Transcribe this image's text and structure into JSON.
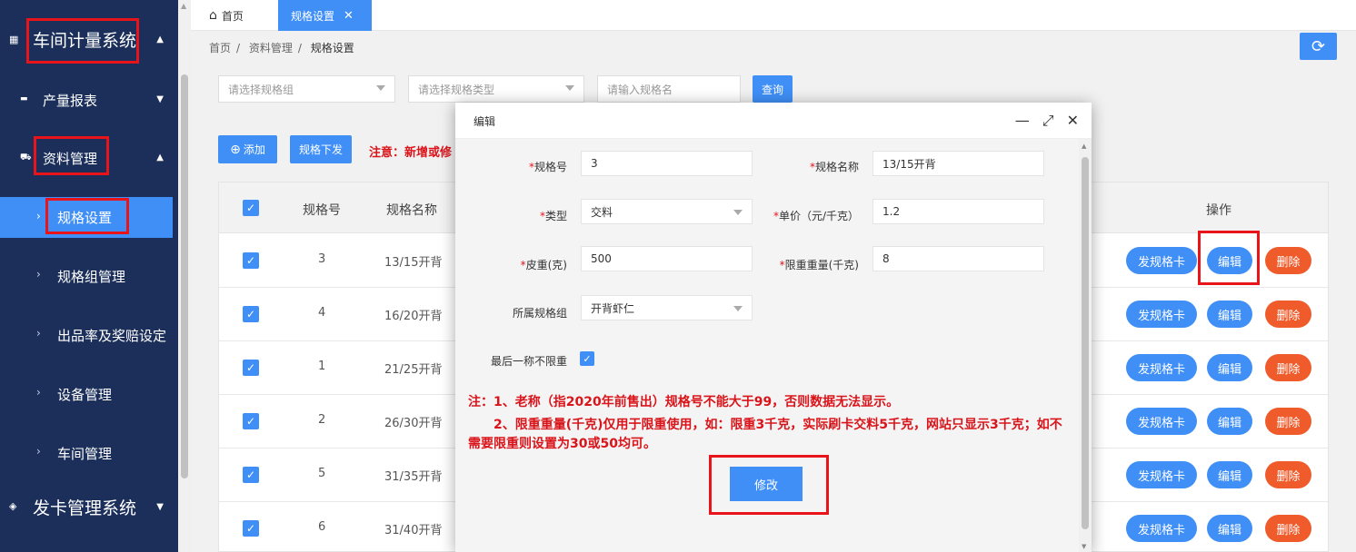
{
  "sidebar": {
    "system_title": "车间计量系统",
    "items": [
      {
        "label": "产量报表"
      },
      {
        "label": "资料管理"
      },
      {
        "label": "规格设置"
      },
      {
        "label": "规格组管理"
      },
      {
        "label": "出品率及奖赔设定"
      },
      {
        "label": "设备管理"
      },
      {
        "label": "车间管理"
      }
    ],
    "card_system": "发卡管理系统"
  },
  "tabs": {
    "home": "首页",
    "active": "规格设置"
  },
  "breadcrumb": [
    "首页",
    "资料管理",
    "规格设置"
  ],
  "filters": {
    "group_placeholder": "请选择规格组",
    "type_placeholder": "请选择规格类型",
    "name_placeholder": "请输入规格名",
    "query_label": "查询"
  },
  "toolbar": {
    "add_label": "添加",
    "dispatch_label": "规格下发",
    "notice": "注意：新增或修"
  },
  "table": {
    "columns": [
      "规格号",
      "规格名称",
      "操作"
    ],
    "rows": [
      {
        "no": "3",
        "name": "13/15开背"
      },
      {
        "no": "4",
        "name": "16/20开背"
      },
      {
        "no": "1",
        "name": "21/25开背"
      },
      {
        "no": "2",
        "name": "26/30开背"
      },
      {
        "no": "5",
        "name": "31/35开背"
      },
      {
        "no": "6",
        "name": "31/40开背"
      }
    ],
    "actions": {
      "card": "发规格卡",
      "edit": "编辑",
      "delete": "删除"
    }
  },
  "dialog": {
    "title": "编辑",
    "fields": {
      "spec_no_label": "规格号",
      "spec_no_value": "3",
      "spec_name_label": "规格名称",
      "spec_name_value": "13/15开背",
      "type_label": "类型",
      "type_value": "交料",
      "price_label": "单价（元/千克）",
      "price_value": "1.2",
      "tare_label": "皮重(克)",
      "tare_value": "500",
      "limit_label": "限重重量(千克)",
      "limit_value": "8",
      "group_label": "所属规格组",
      "group_value": "开背虾仁",
      "last_weigh_label": "最后一称不限重"
    },
    "note_line1": "注：1、老称（指2020年前售出）规格号不能大于99，否则数据无法显示。",
    "note_line2": "　　2、限重重量(千克)仅用于限重使用，如：限重3千克，实际刷卡交料5千克，网站只显示3千克；如不需要限重则设置为30或50均可。",
    "submit_label": "修改"
  },
  "colors": {
    "sidebar_bg": "#1b2f5a",
    "primary": "#3f8ff7",
    "danger": "#ef5b2a",
    "highlight_box": "#e8141a",
    "note_text": "#d9141a"
  }
}
